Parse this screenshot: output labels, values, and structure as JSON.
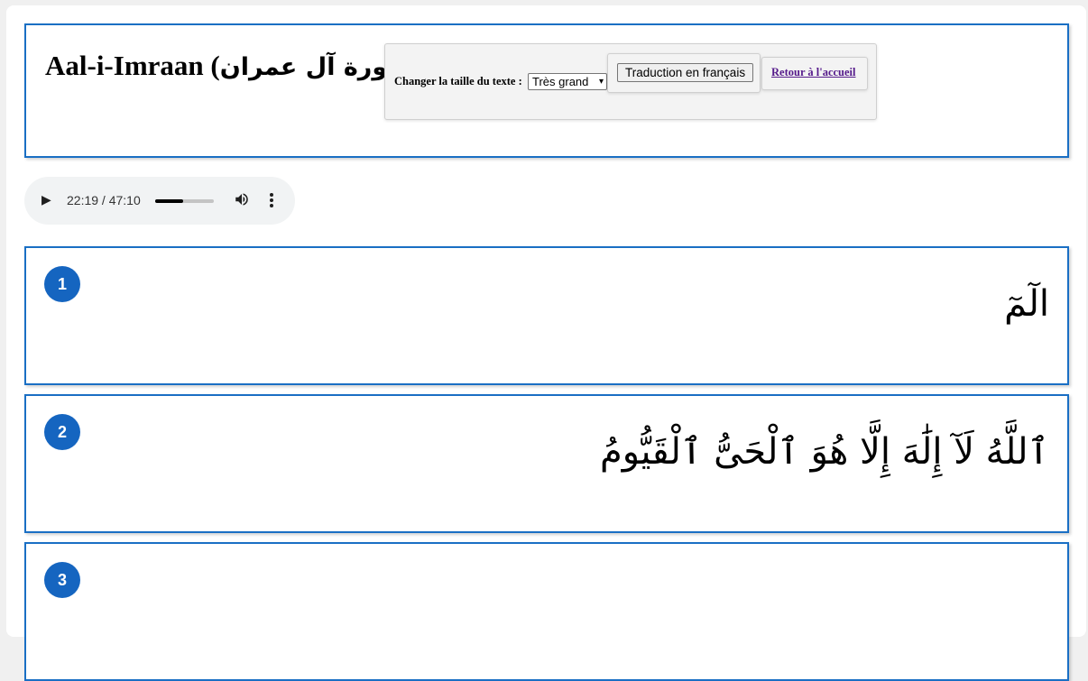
{
  "header": {
    "title_latin": "Aal-i-Imraan (",
    "title_arabic": "سورة آل عمران",
    "title_close": ")",
    "size_label": "Changer la taille du texte :",
    "size_select_value": "Très grand",
    "translation_button": "Traduction en français",
    "home_link": "Retour à l'accueil"
  },
  "audio": {
    "time": "22:19 / 47:10",
    "progress_fraction": 0.473,
    "icons": [
      "play-icon",
      "volume-icon",
      "more-options-icon"
    ]
  },
  "verses": [
    {
      "number": "1",
      "text": "الٓمٓ"
    },
    {
      "number": "2",
      "text": "ٱللَّهُ لَآ إِلَٰهَ إِلَّا هُوَ ٱلْحَىُّ ٱلْقَيُّومُ"
    },
    {
      "number": "3",
      "text": ""
    }
  ],
  "colors": {
    "accent_blue": "#1a6fc4",
    "badge_blue": "#1565c0",
    "visited_link": "#551a8b"
  }
}
